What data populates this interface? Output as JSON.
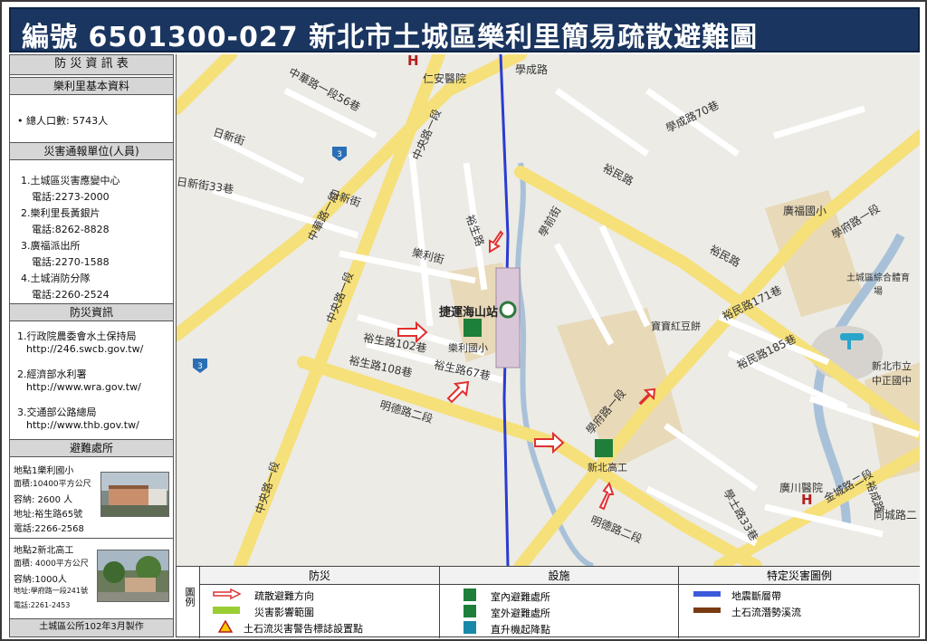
{
  "title": "編號  6501300-027   新北市土城區樂利里簡易疏散避難圖",
  "sidebar": {
    "main_header": "防 災 資 訊 表",
    "basic_header": "樂利里基本資料",
    "population": "• 總人口數:  5743人",
    "notify_header": "災害通報單位(人員)",
    "notify_items": [
      {
        "name": "1.土城區災害應變中心",
        "phone": "電話:2273-2000"
      },
      {
        "name": "2.樂利里長黃銀片",
        "phone": "電話:8262-8828"
      },
      {
        "name": "3.廣福派出所",
        "phone": "電話:2270-1588"
      },
      {
        "name": "4.土城消防分隊",
        "phone": "電話:2260-2524"
      }
    ],
    "info_header": "防災資訊",
    "info_items": [
      {
        "name": "1.行政院農委會水土保持局",
        "url": "http://246.swcb.gov.tw/"
      },
      {
        "name": "2.經濟部水利署",
        "url": "http://www.wra.gov.tw/"
      },
      {
        "name": "3.交通部公路總局",
        "url": "http://www.thb.gov.tw/"
      }
    ],
    "shelter_header": "避難處所",
    "shelters": [
      {
        "lines": [
          "地點1樂利國小",
          "面積:10400平方公尺",
          "容納:  2600  人",
          "地址:裕生路65號",
          "電話:2266-2568"
        ]
      },
      {
        "lines": [
          "地點2新北高工",
          "面積: 4000平方公尺",
          "容納:1000人",
          "地址:學府路一段241號",
          "電話:2261-2453"
        ]
      }
    ],
    "footer": "土城區公所102年3月製作"
  },
  "map": {
    "labels": {
      "hospital1": "仁安醫院",
      "xuecheng": "學成路",
      "yumin": "裕民路",
      "yumin2": "裕民路",
      "xuefu1": "學府路一段",
      "xuefu_mid": "學府路一段",
      "ride": "日新街",
      "ride2": "日新街",
      "ride33": "日新街33巷",
      "zhonghua56": "中華路一段56巷",
      "zhonghua": "中華路一段",
      "zhongyang": "中央路一段",
      "zhongyang2": "中央路一段",
      "zhongyang3": "中央路一段",
      "yuesheng": "裕生路",
      "leli": "樂利街",
      "station": "捷運海山站",
      "school1": "樂利國小",
      "yuesheng102": "裕生路102巷",
      "yuesheng108": "裕生路108巷",
      "yuesheng67": "裕生路67巷",
      "mingde": "明德路二段",
      "mingde2": "明德路二段",
      "school2": "新北高工",
      "guangfu": "廣福國小",
      "sports": "土城區綜合體育場",
      "redbean": "寶寶紅豆餅",
      "yumin171": "裕民路171巷",
      "yumin185": "裕民路185巷",
      "zhongzheng": "新北市立中正國中",
      "guangchuan": "廣川醫院",
      "jincheng": "金城路二段",
      "tongcheng": "同城路二",
      "xueshi33": "學士路33巷",
      "yucheng": "裕成路",
      "xueqian": "學前街",
      "xuecheng70": "學成路70巷",
      "shield": "3"
    }
  },
  "legend": {
    "label": "圖例",
    "col1_header": "防災",
    "col2_header": "設施",
    "col3_header": "特定災害圖例",
    "col1_items": [
      "疏散避難方向",
      "災害影響範圍",
      "土石流災害警告標誌設置點"
    ],
    "col2_items": [
      "室內避難處所",
      "室外避難處所",
      "直升機起降點"
    ],
    "col3_items": [
      "地震斷層帶",
      "土石流潛勢溪流"
    ],
    "colors": {
      "fault": "#3b5bdb",
      "debris": "#7a3b12",
      "impact": "#9acd32",
      "arrow": "#e03030",
      "shelter": "#1e7f3a"
    }
  }
}
